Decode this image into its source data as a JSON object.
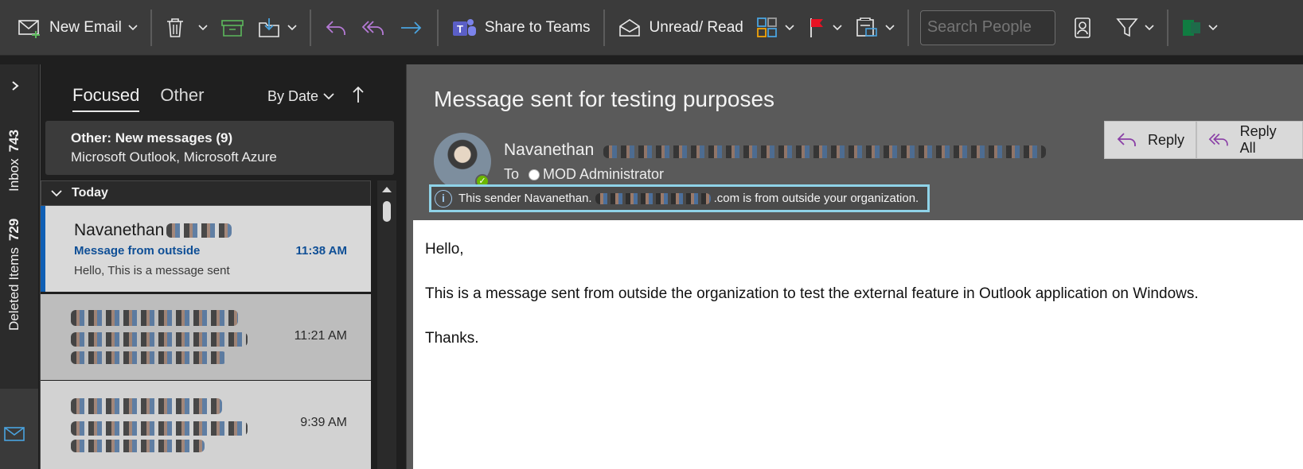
{
  "ribbon": {
    "new_email": "New Email",
    "share_to_teams": "Share to Teams",
    "unread_read": "Unread/ Read",
    "search_placeholder": "Search People"
  },
  "rail": {
    "inbox_label": "Inbox",
    "inbox_count": "743",
    "deleted_label": "Deleted Items",
    "deleted_count": "729"
  },
  "list": {
    "tab_focused": "Focused",
    "tab_other": "Other",
    "sort": "By Date",
    "banner_title": "Other: New messages (9)",
    "banner_senders": "Microsoft Outlook, Microsoft Azure",
    "group": "Today",
    "messages": [
      {
        "sender": "Navanethan",
        "subject": "Message from outside",
        "time": "11:38 AM",
        "preview": "Hello,  This is a message sent"
      },
      {
        "time": "11:21 AM"
      },
      {
        "time": "9:39 AM"
      }
    ]
  },
  "reading": {
    "subject": "Message sent for testing purposes",
    "from_name": "Navanethan",
    "to_label": "To",
    "to_name": "MOD Administrator",
    "reply": "Reply",
    "reply_all": "Reply All",
    "warning_prefix": "This sender Navanethan.",
    "warning_suffix": ".com is from outside your organization.",
    "body": [
      "Hello,",
      "This is a message sent from outside the organization to test the external feature in Outlook application on Windows.",
      "Thanks."
    ]
  },
  "colors": {
    "accent_blue": "#0f5fb4",
    "reply_purple": "#8a3fa6",
    "warning_border": "#8fd3e8"
  },
  "icons": [
    "new-email-icon",
    "delete-icon",
    "archive-icon",
    "move-icon",
    "undo-icon",
    "reply-all-icon",
    "forward-icon",
    "teams-icon",
    "envelope-open-icon",
    "categorize-icon",
    "flag-icon",
    "rules-icon",
    "address-book-icon",
    "filter-icon",
    "excel-icon",
    "info-icon",
    "mail-icon"
  ]
}
